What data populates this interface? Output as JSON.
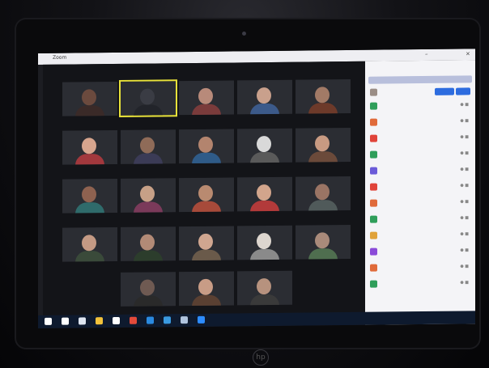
{
  "window": {
    "app_label": "Zoom",
    "meeting_info": "",
    "minimize_icon": "minimize-icon",
    "close_icon": "close-icon"
  },
  "gallery": {
    "tiles": [
      {
        "name": "",
        "skin": "#6b4a3e",
        "shirt": "#3a2a28"
      },
      {
        "name": "",
        "skin": "#3a3c44",
        "shirt": "#22242a",
        "active": true
      },
      {
        "name": "",
        "skin": "#b88a7a",
        "shirt": "#7a3b3b"
      },
      {
        "name": "",
        "skin": "#c9a08c",
        "shirt": "#3c5a8a"
      },
      {
        "name": "",
        "skin": "#a27a66",
        "shirt": "#6d3a2a"
      },
      {
        "name": "",
        "skin": "#d7a58e",
        "shirt": "#a2383d"
      },
      {
        "name": "",
        "skin": "#8f6b58",
        "shirt": "#3b3b56"
      },
      {
        "name": "",
        "skin": "#b3846e",
        "shirt": "#2f5b88"
      },
      {
        "name": "",
        "skin": "#d9d9d9",
        "shirt": "#5a5a5a"
      },
      {
        "name": "",
        "skin": "#c89a82",
        "shirt": "#6b4a3a"
      },
      {
        "name": "",
        "skin": "#8e6250",
        "shirt": "#2f6b6b"
      },
      {
        "name": "",
        "skin": "#c7a087",
        "shirt": "#7a3a5a"
      },
      {
        "name": "",
        "skin": "#b98a70",
        "shirt": "#a74a3a"
      },
      {
        "name": "",
        "skin": "#d2a58c",
        "shirt": "#b23a3a"
      },
      {
        "name": "",
        "skin": "#9a7464",
        "shirt": "#505a5a"
      },
      {
        "name": "",
        "skin": "#c49a84",
        "shirt": "#3a4a3a"
      },
      {
        "name": "",
        "skin": "#b28a76",
        "shirt": "#2c3d2c"
      },
      {
        "name": "",
        "skin": "#d0a690",
        "shirt": "#6a5a4a"
      },
      {
        "name": "",
        "skin": "#ddd6cf",
        "shirt": "#8a8a8a"
      },
      {
        "name": "",
        "skin": "#a98a7a",
        "shirt": "#4f6e4f"
      },
      {
        "name": "",
        "skin": "#6f5a52",
        "shirt": "#2a2a2a"
      },
      {
        "name": "",
        "skin": "#c89c86",
        "shirt": "#5a4032"
      },
      {
        "name": "",
        "skin": "#b7927e",
        "shirt": "#3a3a3a"
      }
    ]
  },
  "participants": {
    "panel_title": "",
    "search_placeholder": "",
    "host": {
      "name": "",
      "mute_label": "",
      "more_label": ""
    },
    "rows": [
      {
        "name": "",
        "color": "#2f9e5a"
      },
      {
        "name": "",
        "color": "#e06a3a"
      },
      {
        "name": "",
        "color": "#e0433a"
      },
      {
        "name": "",
        "color": "#2f9e5a"
      },
      {
        "name": "",
        "color": "#6a5ad8"
      },
      {
        "name": "",
        "color": "#e0433a"
      },
      {
        "name": "",
        "color": "#e06a3a"
      },
      {
        "name": "",
        "color": "#2f9e5a"
      },
      {
        "name": "",
        "color": "#e0a23a"
      },
      {
        "name": "",
        "color": "#8a4ad8"
      },
      {
        "name": "",
        "color": "#e06a3a"
      },
      {
        "name": "",
        "color": "#2f9e5a"
      }
    ],
    "footer_left": "",
    "footer_right": "",
    "row_icons": "mic-icon video-icon"
  },
  "taskbar": {
    "icons": [
      {
        "name": "windows-start-icon",
        "color": "#ffffff"
      },
      {
        "name": "search-icon",
        "color": "#ffffff"
      },
      {
        "name": "task-view-icon",
        "color": "#dfe6f1"
      },
      {
        "name": "file-explorer-icon",
        "color": "#f2c23a"
      },
      {
        "name": "store-icon",
        "color": "#ffffff"
      },
      {
        "name": "chrome-icon",
        "color": "#e34a3a"
      },
      {
        "name": "edge-icon",
        "color": "#2a8ae0"
      },
      {
        "name": "mail-icon",
        "color": "#3a9ae0"
      },
      {
        "name": "photos-icon",
        "color": "#b0c4de"
      },
      {
        "name": "zoom-icon",
        "color": "#2d8cff"
      }
    ],
    "tray_time": "",
    "tray_date": ""
  },
  "device_logo": "hp-logo-icon"
}
